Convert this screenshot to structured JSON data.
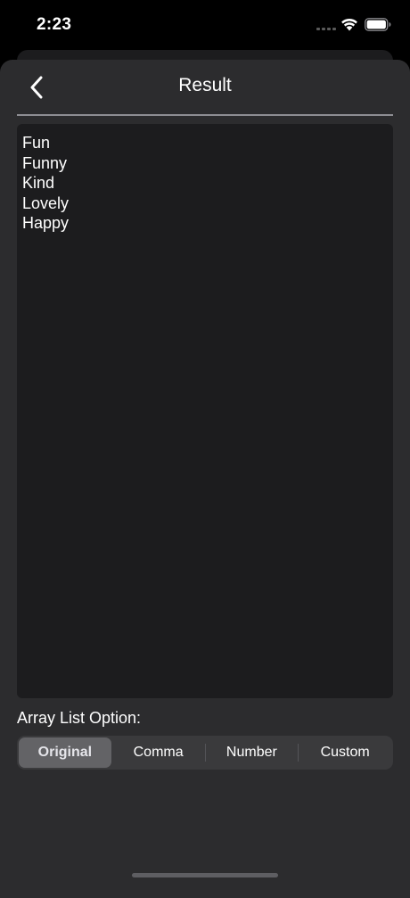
{
  "status_bar": {
    "time": "2:23"
  },
  "nav": {
    "title": "Result",
    "back_icon": "chevron-left-icon"
  },
  "result": {
    "lines": [
      "Fun",
      "Funny",
      "Kind",
      "Lovely",
      "Happy"
    ]
  },
  "options": {
    "label": "Array List Option:",
    "segments": [
      "Original",
      "Comma",
      "Number",
      "Custom"
    ],
    "selected": "Original"
  },
  "colors": {
    "background": "#000000",
    "sheet": "#2c2c2e",
    "text_area": "#1c1c1e",
    "segment_bg": "#3a3a3c",
    "segment_selected": "#636366",
    "text": "#ffffff"
  }
}
